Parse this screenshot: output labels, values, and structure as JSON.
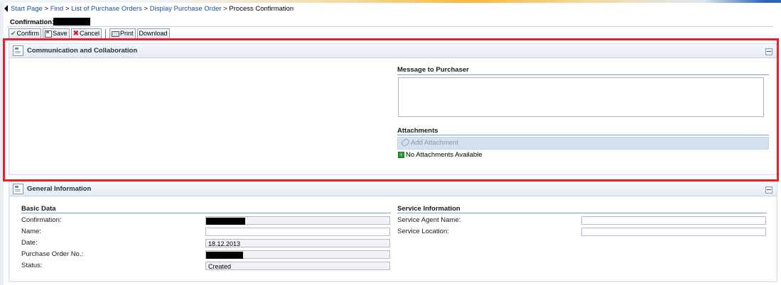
{
  "breadcrumb": {
    "items": [
      "Start Page",
      "Find",
      "List of Purchase Orders",
      "Display Purchase Order"
    ],
    "current": "Process Confirmation",
    "separator": ">"
  },
  "page_title": "Confirmation:",
  "toolbar": {
    "confirm": "Confirm",
    "save": "Save",
    "cancel": "Cancel",
    "print": "Print",
    "download": "Download"
  },
  "communication_panel": {
    "title": "Communication and Collaboration",
    "message_heading": "Message to Purchaser",
    "message_value": "",
    "attachments_heading": "Attachments",
    "add_attachment_label": "Add Attachment",
    "no_attachments_text": "No Attachments Available"
  },
  "general_panel": {
    "title": "General Information",
    "basic_data": {
      "heading": "Basic Data",
      "labels": {
        "confirmation": "Confirmation:",
        "name": "Name:",
        "date": "Date:",
        "purchase_order_no": "Purchase Order No.:",
        "status": "Status:"
      },
      "values": {
        "name": "",
        "date": "18.12.2013",
        "status": "Created"
      }
    },
    "service_info": {
      "heading": "Service Information",
      "labels": {
        "service_agent_name": "Service Agent Name:",
        "service_location": "Service Location:"
      },
      "values": {
        "service_agent_name": "",
        "service_location": ""
      }
    }
  },
  "colors": {
    "link": "#1b4f9a",
    "highlight_outline": "#e4212c",
    "section_line": "#7fa0c8",
    "panel_header": "#e3ebf3"
  }
}
